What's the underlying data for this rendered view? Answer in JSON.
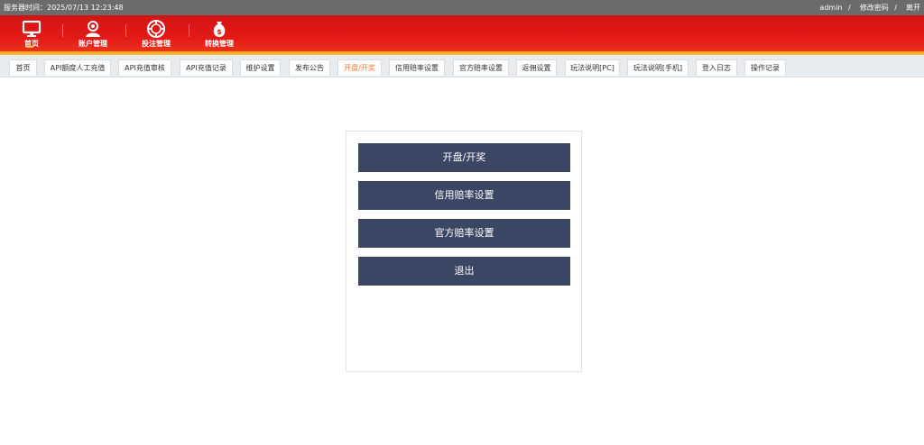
{
  "topbar": {
    "server_time_label": "服务器时间：",
    "server_time": "2025/07/13 12:23:48",
    "user": "admin",
    "separator": "/",
    "change_password": "修改密码",
    "logout": "离开"
  },
  "nav": {
    "items": [
      {
        "label": "首页",
        "icon": "monitor-icon",
        "active": true
      },
      {
        "label": "账户管理",
        "icon": "user-icon"
      },
      {
        "label": "投注管理",
        "icon": "chip-icon"
      },
      {
        "label": "转换管理",
        "icon": "money-bag-icon"
      }
    ]
  },
  "tabs": [
    {
      "label": "首页"
    },
    {
      "label": "API额度人工充值"
    },
    {
      "label": "API充值审核"
    },
    {
      "label": "API充值记录"
    },
    {
      "label": "维护设置"
    },
    {
      "label": "发布公告"
    },
    {
      "label": "开盘/开奖",
      "active": true
    },
    {
      "label": "信用赔率设置"
    },
    {
      "label": "官方赔率设置"
    },
    {
      "label": "返佣设置"
    },
    {
      "label": "玩法说明[PC]"
    },
    {
      "label": "玩法说明[手机]"
    },
    {
      "label": "登入日志"
    },
    {
      "label": "操作记录"
    }
  ],
  "panel": {
    "buttons": [
      {
        "label": "开盘/开奖"
      },
      {
        "label": "信用赔率设置"
      },
      {
        "label": "官方赔率设置"
      },
      {
        "label": "退出"
      }
    ]
  },
  "colors": {
    "header_red": "#e41b17",
    "accent_orange": "#ff7a2f",
    "button_navy": "#3a4663"
  }
}
